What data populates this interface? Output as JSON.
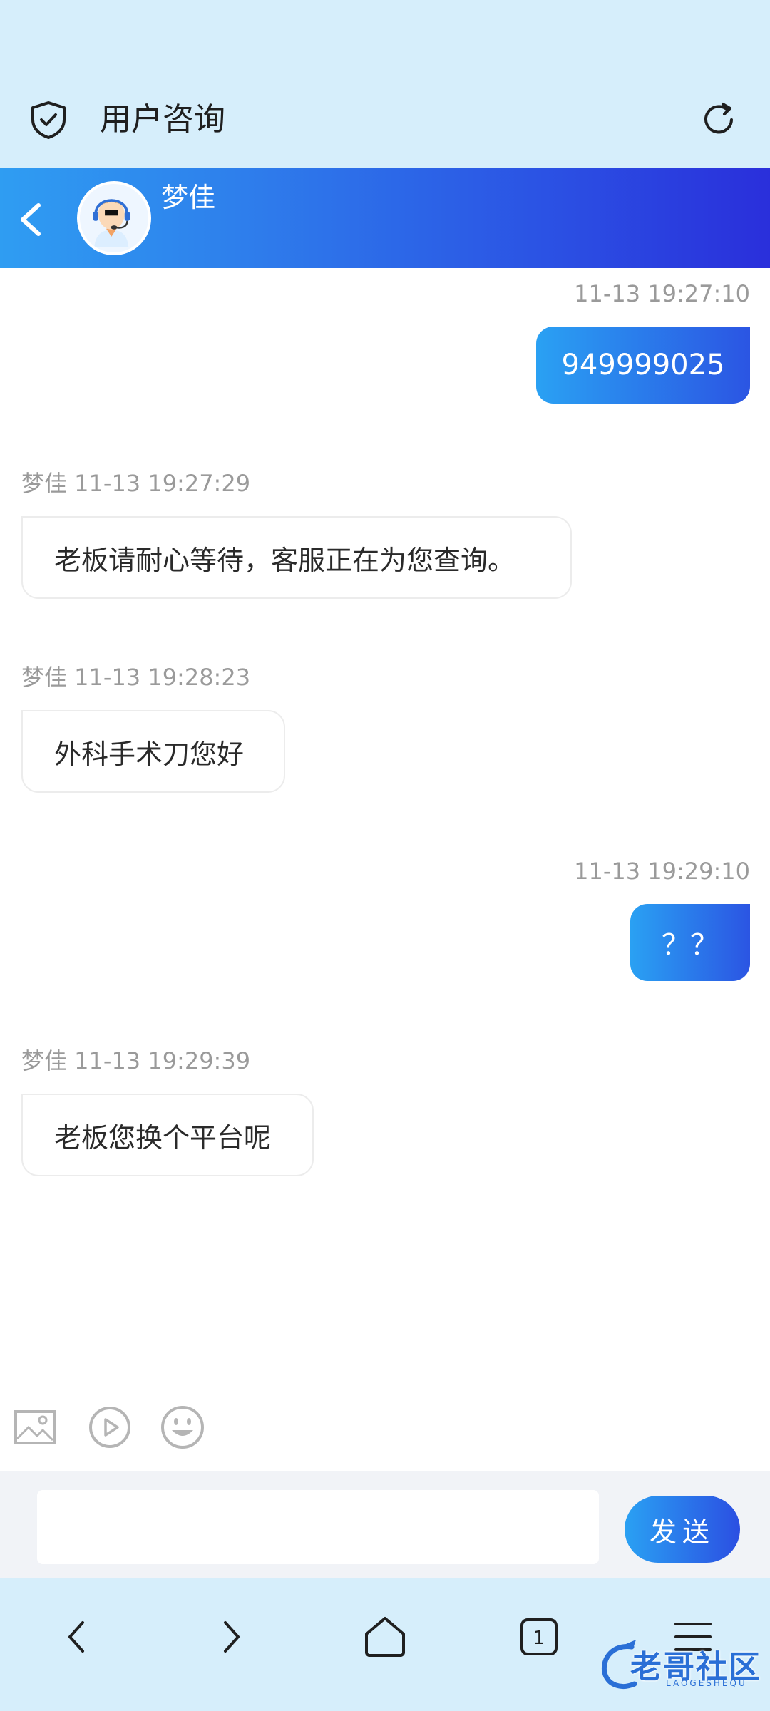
{
  "header": {
    "title": "用户咨询"
  },
  "chat_header": {
    "agent_name": "梦佳"
  },
  "messages": [
    {
      "direction": "out",
      "timestamp": "11-13 19:27:10",
      "text": "949999025"
    },
    {
      "direction": "in",
      "sender": "梦佳",
      "timestamp": "11-13 19:27:29",
      "text": "老板请耐心等待，客服正在为您查询。"
    },
    {
      "direction": "in",
      "sender": "梦佳",
      "timestamp": "11-13 19:28:23",
      "text": "外科手术刀您好"
    },
    {
      "direction": "out",
      "timestamp": "11-13 19:29:10",
      "text": "？？"
    },
    {
      "direction": "in",
      "sender": "梦佳",
      "timestamp": "11-13 19:29:39",
      "text": "老板您换个平台呢"
    }
  ],
  "messages_meta": {
    "in_1": "梦佳 11-13 19:27:29",
    "in_2": "梦佳 11-13 19:28:23",
    "in_3": "梦佳 11-13 19:29:39"
  },
  "toolbar": {
    "icons": [
      "image-icon",
      "video-icon",
      "emoji-icon"
    ]
  },
  "input": {
    "value": "",
    "placeholder": ""
  },
  "send_button": {
    "label": "发送"
  },
  "browser_nav": {
    "tab_count": "1"
  },
  "watermark": {
    "text": "老哥社区",
    "subtext": "LAOGESHEQU"
  },
  "colors": {
    "top_background": "#d6eefb",
    "header_gradient_start": "#2f9df2",
    "header_gradient_end": "#2a2fdb",
    "timestamp_gray": "#9a9a9a",
    "input_bar_background": "#f1f3f7"
  }
}
